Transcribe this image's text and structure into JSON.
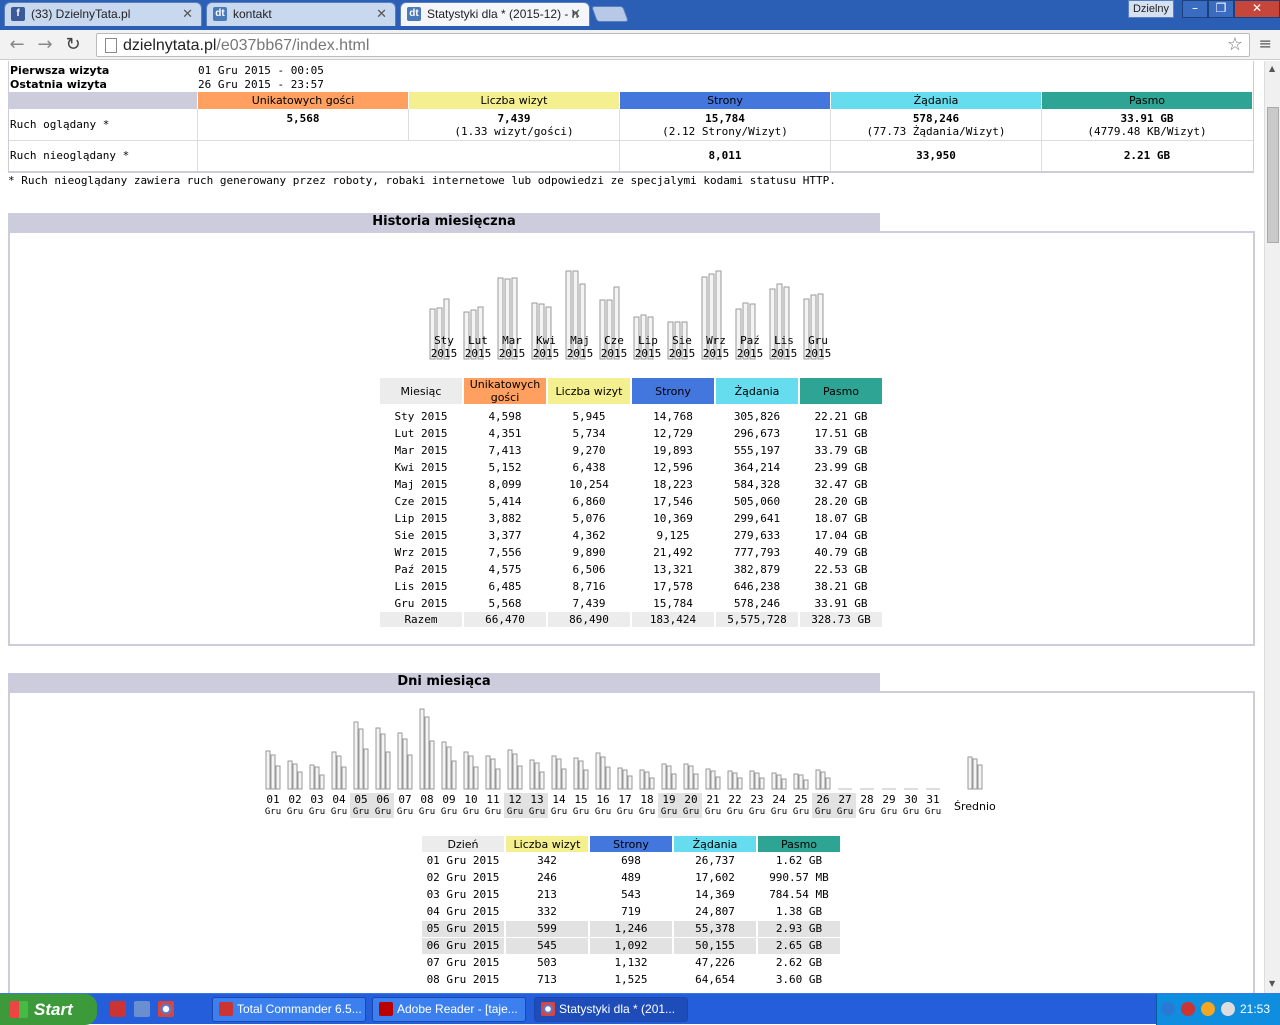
{
  "browser": {
    "tabs": [
      {
        "label": "(33) DzielnyTata.pl",
        "favicon": "facebook-icon"
      },
      {
        "label": "kontakt",
        "favicon": "dt-icon"
      },
      {
        "label": "Statystyki dla * (2015-12) - n",
        "favicon": "dt-icon"
      }
    ],
    "profile_label": "Dzielny",
    "url_host": "dzielnytata.pl",
    "url_path": "/e037bb67/index.html"
  },
  "summary": {
    "first_visit_label": "Pierwsza wizyta",
    "first_visit_value": "01 Gru 2015 - 00:05",
    "last_visit_label": "Ostatnia wizyta",
    "last_visit_value": "26 Gru 2015 - 23:57",
    "headers": [
      "Unikatowych gości",
      "Liczba wizyt",
      "Strony",
      "Żądania",
      "Pasmo"
    ],
    "viewed_label": "Ruch oglądany *",
    "viewed": [
      {
        "main": "5,568",
        "sub": ""
      },
      {
        "main": "7,439",
        "sub": "(1.33 wizyt/gości)"
      },
      {
        "main": "15,784",
        "sub": "(2.12 Strony/Wizyt)"
      },
      {
        "main": "578,246",
        "sub": "(77.73 Żądania/Wizyt)"
      },
      {
        "main": "33.91 GB",
        "sub": "(4779.48 KB/Wizyt)"
      }
    ],
    "notviewed_label": "Ruch nieoglądany *",
    "notviewed": [
      "",
      "",
      "8,011",
      "33,950",
      "2.21 GB"
    ],
    "footnote": "* Ruch nieoglądany zawiera ruch generowany przez roboty, robaki internetowe lub odpowiedzi ze specjalymi kodami statusu HTTP."
  },
  "monthly": {
    "title": "Historia miesięczna",
    "chart_labels": [
      [
        "Sty",
        "2015"
      ],
      [
        "Lut",
        "2015"
      ],
      [
        "Mar",
        "2015"
      ],
      [
        "Kwi",
        "2015"
      ],
      [
        "Maj",
        "2015"
      ],
      [
        "Cze",
        "2015"
      ],
      [
        "Lip",
        "2015"
      ],
      [
        "Sie",
        "2015"
      ],
      [
        "Wrz",
        "2015"
      ],
      [
        "Paź",
        "2015"
      ],
      [
        "Lis",
        "2015"
      ],
      [
        "Gru",
        "2015"
      ]
    ],
    "headers": [
      "Miesiąc",
      "Unikatowych gości",
      "Liczba wizyt",
      "Strony",
      "Żądania",
      "Pasmo"
    ],
    "rows": [
      [
        "Sty 2015",
        "4,598",
        "5,945",
        "14,768",
        "305,826",
        "22.21 GB"
      ],
      [
        "Lut 2015",
        "4,351",
        "5,734",
        "12,729",
        "296,673",
        "17.51 GB"
      ],
      [
        "Mar 2015",
        "7,413",
        "9,270",
        "19,893",
        "555,197",
        "33.79 GB"
      ],
      [
        "Kwi 2015",
        "5,152",
        "6,438",
        "12,596",
        "364,214",
        "23.99 GB"
      ],
      [
        "Maj 2015",
        "8,099",
        "10,254",
        "18,223",
        "584,328",
        "32.47 GB"
      ],
      [
        "Cze 2015",
        "5,414",
        "6,860",
        "17,546",
        "505,060",
        "28.20 GB"
      ],
      [
        "Lip 2015",
        "3,882",
        "5,076",
        "10,369",
        "299,641",
        "18.07 GB"
      ],
      [
        "Sie 2015",
        "3,377",
        "4,362",
        "9,125",
        "279,633",
        "17.04 GB"
      ],
      [
        "Wrz 2015",
        "7,556",
        "9,890",
        "21,492",
        "777,793",
        "40.79 GB"
      ],
      [
        "Paź 2015",
        "4,575",
        "6,506",
        "13,321",
        "382,879",
        "22.53 GB"
      ],
      [
        "Lis 2015",
        "6,485",
        "8,716",
        "17,578",
        "646,238",
        "38.21 GB"
      ],
      [
        "Gru 2015",
        "5,568",
        "7,439",
        "15,784",
        "578,246",
        "33.91 GB"
      ]
    ],
    "total": [
      "Razem",
      "66,470",
      "86,490",
      "183,424",
      "5,575,728",
      "328.73 GB"
    ]
  },
  "daily": {
    "title": "Dni miesiąca",
    "day_labels": [
      "01",
      "02",
      "03",
      "04",
      "05",
      "06",
      "07",
      "08",
      "09",
      "10",
      "11",
      "12",
      "13",
      "14",
      "15",
      "16",
      "17",
      "18",
      "19",
      "20",
      "21",
      "22",
      "23",
      "24",
      "25",
      "26",
      "27",
      "28",
      "29",
      "30",
      "31"
    ],
    "weekend_days": [
      "05",
      "06",
      "12",
      "13",
      "19",
      "20",
      "26",
      "27"
    ],
    "month_label": "Gru",
    "average_label": "Średnio",
    "headers": [
      "Dzień",
      "Liczba wizyt",
      "Strony",
      "Żądania",
      "Pasmo"
    ],
    "rows": [
      [
        "01 Gru 2015",
        "342",
        "698",
        "26,737",
        "1.62 GB"
      ],
      [
        "02 Gru 2015",
        "246",
        "489",
        "17,602",
        "990.57 MB"
      ],
      [
        "03 Gru 2015",
        "213",
        "543",
        "14,369",
        "784.54 MB"
      ],
      [
        "04 Gru 2015",
        "332",
        "719",
        "24,807",
        "1.38 GB"
      ],
      [
        "05 Gru 2015",
        "599",
        "1,246",
        "55,378",
        "2.93 GB"
      ],
      [
        "06 Gru 2015",
        "545",
        "1,092",
        "50,155",
        "2.65 GB"
      ],
      [
        "07 Gru 2015",
        "503",
        "1,132",
        "47,226",
        "2.62 GB"
      ],
      [
        "08 Gru 2015",
        "713",
        "1,525",
        "64,654",
        "3.60 GB"
      ]
    ]
  },
  "chart_data": [
    {
      "type": "bar",
      "title": "Historia miesięczna",
      "categories": [
        "Sty 2015",
        "Lut 2015",
        "Mar 2015",
        "Kwi 2015",
        "Maj 2015",
        "Cze 2015",
        "Lip 2015",
        "Sie 2015",
        "Wrz 2015",
        "Paź 2015",
        "Lis 2015",
        "Gru 2015"
      ],
      "series": [
        {
          "name": "Unikatowych gości",
          "values": [
            4598,
            4351,
            7413,
            5152,
            8099,
            5414,
            3882,
            3377,
            7556,
            4575,
            6485,
            5568
          ]
        },
        {
          "name": "Liczba wizyt",
          "values": [
            5945,
            5734,
            9270,
            6438,
            10254,
            6860,
            5076,
            4362,
            9890,
            6506,
            8716,
            7439
          ]
        },
        {
          "name": "Strony",
          "values": [
            14768,
            12729,
            19893,
            12596,
            18223,
            17546,
            10369,
            9125,
            21492,
            13321,
            17578,
            15784
          ]
        },
        {
          "name": "Żądania",
          "values": [
            305826,
            296673,
            555197,
            364214,
            584328,
            505060,
            299641,
            279633,
            777793,
            382879,
            646238,
            578246
          ]
        },
        {
          "name": "Pasmo",
          "values": [
            22.21,
            17.51,
            33.79,
            23.99,
            32.47,
            28.2,
            18.07,
            17.04,
            40.79,
            22.53,
            38.21,
            33.91
          ]
        }
      ]
    },
    {
      "type": "bar",
      "title": "Dni miesiąca",
      "categories": [
        "01",
        "02",
        "03",
        "04",
        "05",
        "06",
        "07",
        "08",
        "09",
        "10",
        "11",
        "12",
        "13",
        "14",
        "15",
        "16",
        "17",
        "18",
        "19",
        "20",
        "21",
        "22",
        "23",
        "24",
        "25",
        "26",
        "27",
        "28",
        "29",
        "30",
        "31"
      ],
      "series": [
        {
          "name": "Liczba wizyt",
          "values": [
            342,
            246,
            213,
            332,
            599,
            545,
            503,
            713,
            420,
            330,
            290,
            350,
            260,
            290,
            280,
            320,
            190,
            170,
            220,
            220,
            180,
            160,
            160,
            140,
            130,
            170,
            0,
            0,
            0,
            0,
            0
          ]
        }
      ]
    }
  ],
  "taskbar": {
    "start_label": "Start",
    "tasks": [
      "Total Commander 6.5...",
      "Adobe Reader - [taje...",
      "Statystyki dla * (201..."
    ],
    "clock": "21:53"
  }
}
